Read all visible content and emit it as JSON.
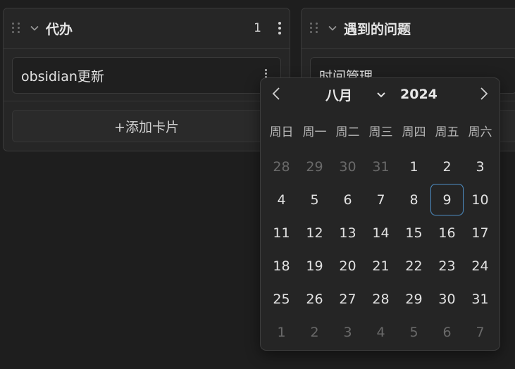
{
  "lanes": [
    {
      "title": "代办",
      "count": "1",
      "cards": [
        "obsidian更新"
      ],
      "add_card_label": "+添加卡片"
    },
    {
      "title": "遇到的问题",
      "cards": [
        "时间管理"
      ]
    }
  ],
  "date_picker": {
    "month": "八月",
    "year": "2024",
    "weekdays": [
      "周日",
      "周一",
      "周二",
      "周三",
      "周四",
      "周五",
      "周六"
    ],
    "weeks": [
      [
        "28",
        "29",
        "30",
        "31",
        "1",
        "2",
        "3"
      ],
      [
        "4",
        "5",
        "6",
        "7",
        "8",
        "9",
        "10"
      ],
      [
        "11",
        "12",
        "13",
        "14",
        "15",
        "16",
        "17"
      ],
      [
        "18",
        "19",
        "20",
        "21",
        "22",
        "23",
        "24"
      ],
      [
        "25",
        "26",
        "27",
        "28",
        "29",
        "30",
        "31"
      ],
      [
        "1",
        "2",
        "3",
        "4",
        "5",
        "6",
        "7"
      ]
    ],
    "selected_day": "9",
    "selected_color": "#4e8ec5"
  }
}
